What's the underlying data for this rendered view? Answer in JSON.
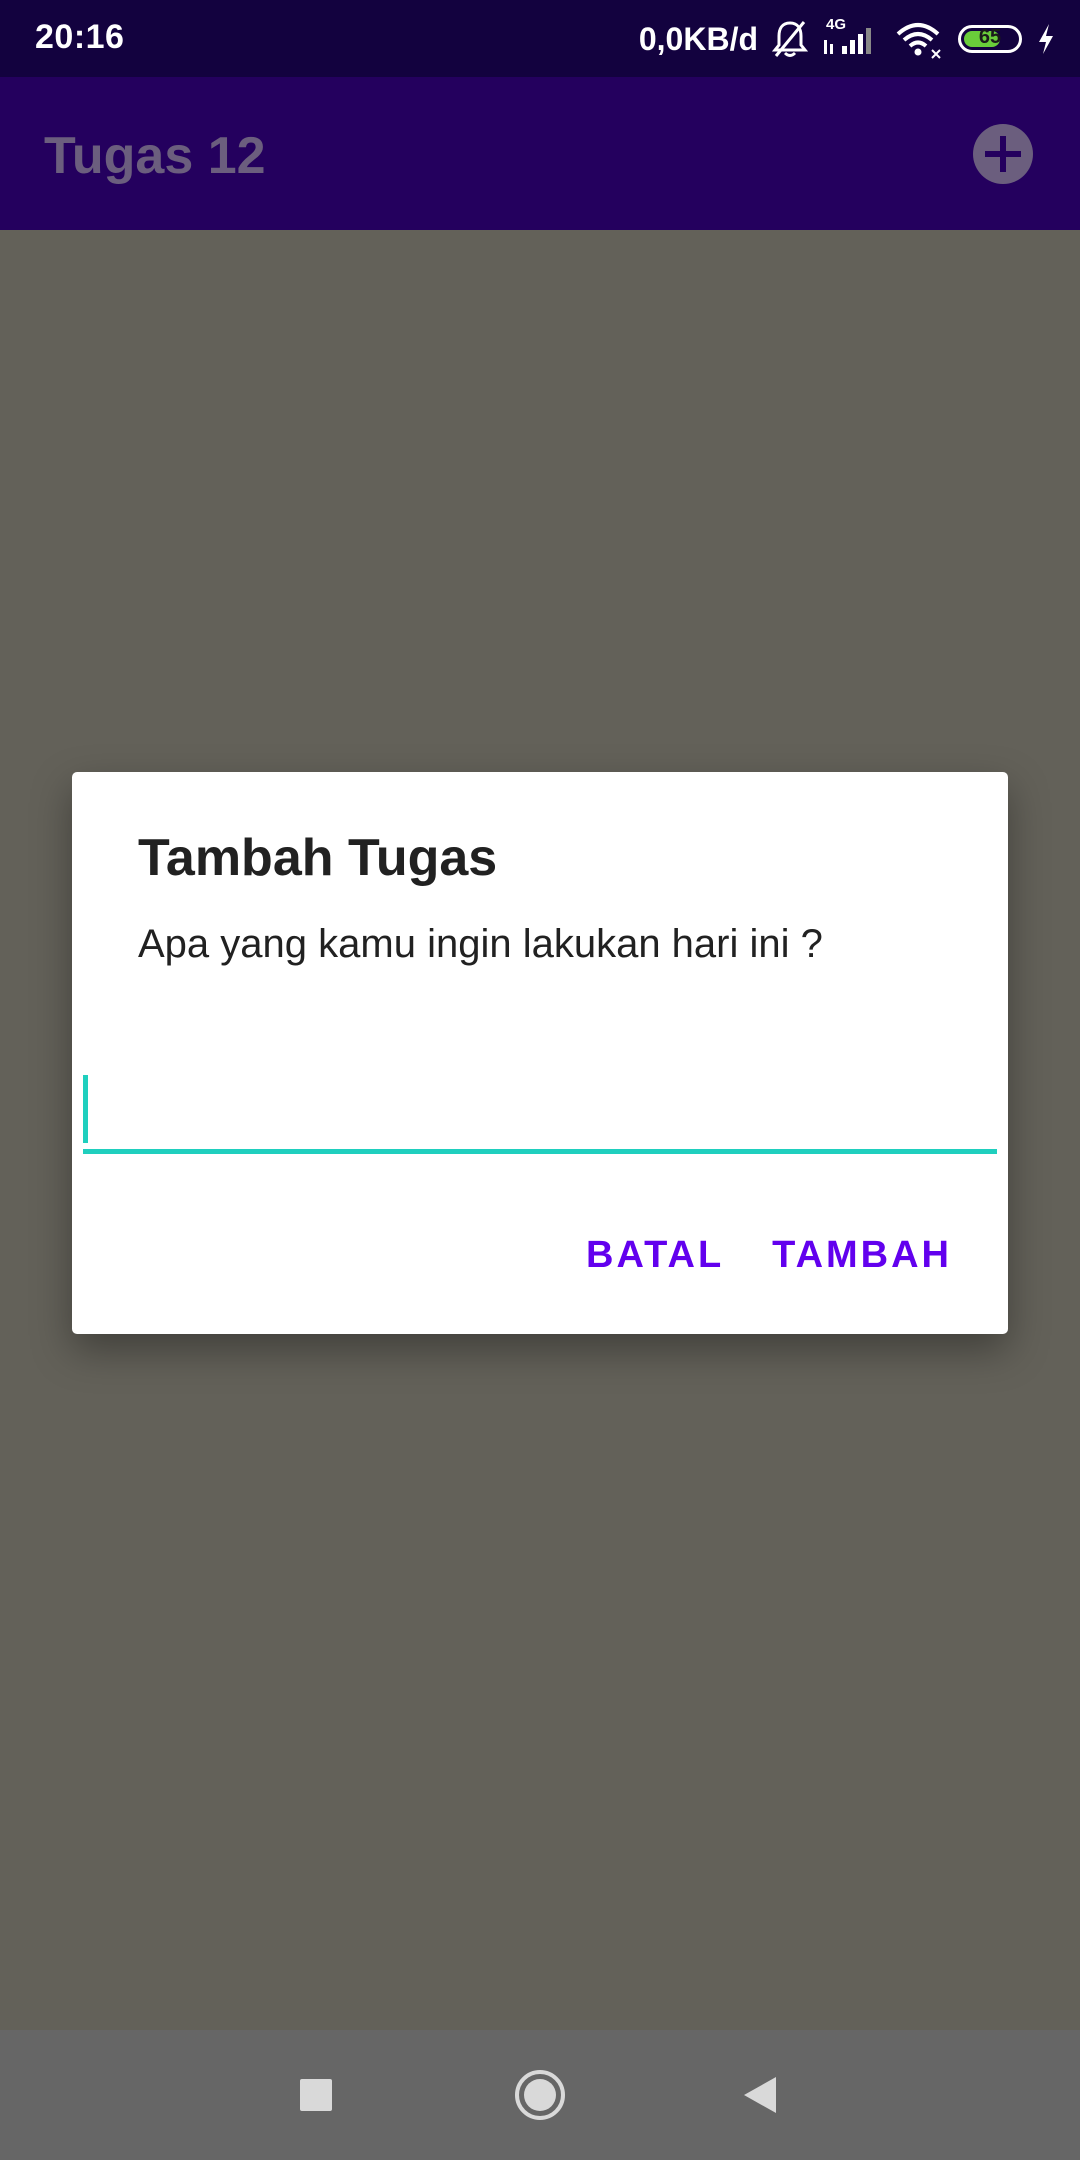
{
  "status_bar": {
    "time": "20:16",
    "net_speed": "0,0KB/d",
    "network_type": "4G",
    "battery_level": "65",
    "icons": [
      "bell-off-icon",
      "signal-icon",
      "wifi-icon",
      "battery-icon",
      "charging-icon"
    ]
  },
  "app_bar": {
    "title": "Tugas 12",
    "action_icon": "add-circle-icon"
  },
  "dialog": {
    "title": "Tambah Tugas",
    "message": "Apa yang kamu ingin lakukan hari ini ?",
    "input_value": "",
    "buttons": {
      "cancel": "BATAL",
      "confirm": "TAMBAH"
    }
  },
  "nav_bar": {
    "icons": [
      "recents-icon",
      "home-icon",
      "back-icon"
    ]
  },
  "colors": {
    "status_bar": "#13023f",
    "app_bar_dimmed": "#24005e",
    "scrim": "#636159",
    "accent": "#6200ee",
    "input_underline": "#1fcfbe",
    "nav_bar": "#666666"
  }
}
